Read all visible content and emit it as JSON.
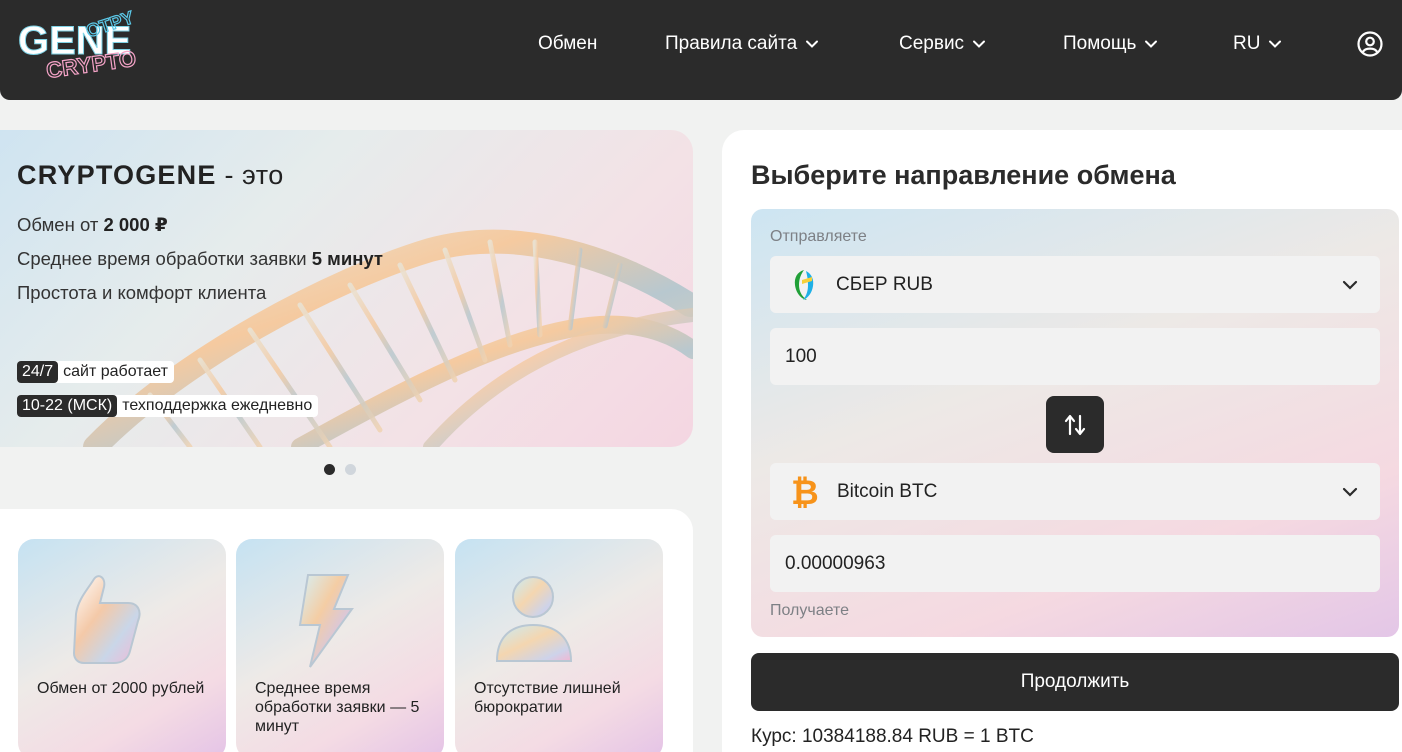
{
  "header": {
    "logo_text": "GENE CRYPTO",
    "nav": [
      {
        "label": "Обмен",
        "dropdown": false
      },
      {
        "label": "Правила сайта",
        "dropdown": true
      },
      {
        "label": "Сервис",
        "dropdown": true
      },
      {
        "label": "Помощь",
        "dropdown": true
      },
      {
        "label": "RU",
        "dropdown": true
      }
    ],
    "user_icon": "user-circle-icon"
  },
  "hero": {
    "title_brand": "CRYPTOGENE",
    "title_suffix": " - это",
    "line1_text": "Обмен от ",
    "line1_bold": "2 000 ₽",
    "line2_text": "Среднее время обработки заявки ",
    "line2_bold": "5 минут",
    "line3_text": "Простота и комфорт клиента",
    "badge1_dark": "24/7",
    "badge1_text": "сайт работает",
    "badge2_dark": "10-22 (МСК)",
    "badge2_text": "техподдержка ежедневно",
    "slides_total": 2,
    "slide_active": 1
  },
  "features": [
    {
      "text": "Обмен от 2000 рублей",
      "icon": "thumbs-up-icon"
    },
    {
      "text": "Среднее время обработки заявки — 5 минут",
      "icon": "lightning-icon"
    },
    {
      "text": "Отсутствие лишней бюрократии",
      "icon": "user-icon"
    }
  ],
  "exchange": {
    "title": "Выберите направление обмена",
    "send_label": "Отправляете",
    "send_currency": "СБЕР RUB",
    "send_amount": "100",
    "receive_currency": "Bitcoin BTC",
    "receive_amount": "0.00000963",
    "receive_label": "Получаете",
    "continue_label": "Продолжить",
    "rate_text": "Курс: 10384188.84 RUB = 1 BTC"
  },
  "colors": {
    "dark": "#2b2b2b",
    "background": "#f1f2f1",
    "sber_green": "#21a038",
    "bitcoin_orange": "#f7931a"
  }
}
